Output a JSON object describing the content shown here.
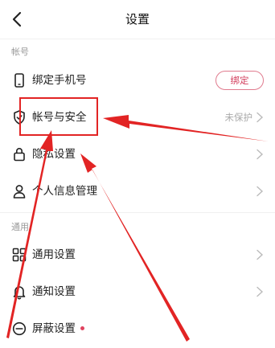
{
  "header": {
    "title": "设置",
    "back_icon": "chevron-left-icon"
  },
  "sections": [
    {
      "title": "帐号"
    },
    {
      "title": "通用"
    }
  ],
  "rows": [
    {
      "label": "绑定手机号",
      "icon": "phone-icon",
      "action_label": "绑定"
    },
    {
      "label": "帐号与安全",
      "icon": "shield-icon",
      "status": "未保护"
    },
    {
      "label": "隐私设置",
      "icon": "lock-icon"
    },
    {
      "label": "个人信息管理",
      "icon": "person-icon"
    },
    {
      "label": "通用设置",
      "icon": "grid-icon"
    },
    {
      "label": "通知设置",
      "icon": "bell-icon"
    },
    {
      "label": "屏蔽设置",
      "icon": "block-icon"
    }
  ],
  "colors": {
    "accent": "#d23b5a",
    "annotation_red": "#e22424",
    "muted": "#999999"
  }
}
